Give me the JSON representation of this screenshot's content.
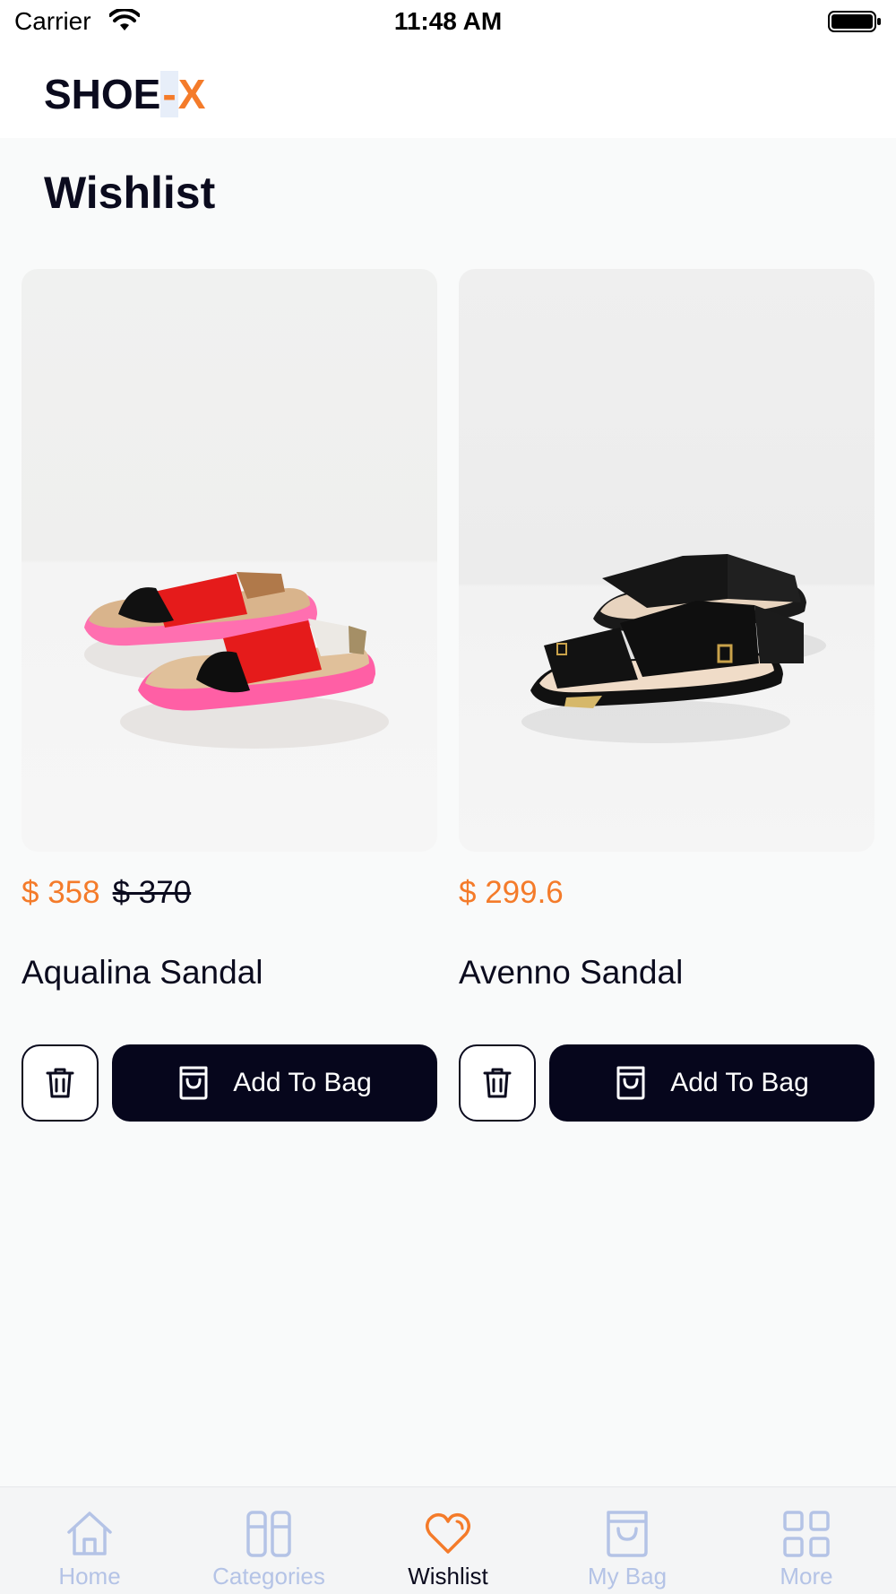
{
  "status_bar": {
    "carrier": "Carrier",
    "time": "11:48 AM"
  },
  "header": {
    "logo_main": "SHOE",
    "logo_dash": "-",
    "logo_x": "X"
  },
  "page": {
    "title": "Wishlist"
  },
  "products": [
    {
      "name": "Aqualina Sandal",
      "price": "$ 358",
      "old_price": "$ 370",
      "add_label": "Add To Bag"
    },
    {
      "name": "Avenno Sandal",
      "price": "$ 299.6",
      "add_label": "Add To Bag"
    }
  ],
  "tabs": [
    {
      "label": "Home",
      "icon": "home-icon"
    },
    {
      "label": "Categories",
      "icon": "categories-icon"
    },
    {
      "label": "Wishlist",
      "icon": "heart-icon",
      "active": true
    },
    {
      "label": "My Bag",
      "icon": "bag-icon"
    },
    {
      "label": "More",
      "icon": "grid-icon"
    }
  ],
  "colors": {
    "accent": "#f47b2a",
    "dark": "#06061c",
    "tab_inactive": "#b4c3e6",
    "background": "#f9fafa"
  }
}
